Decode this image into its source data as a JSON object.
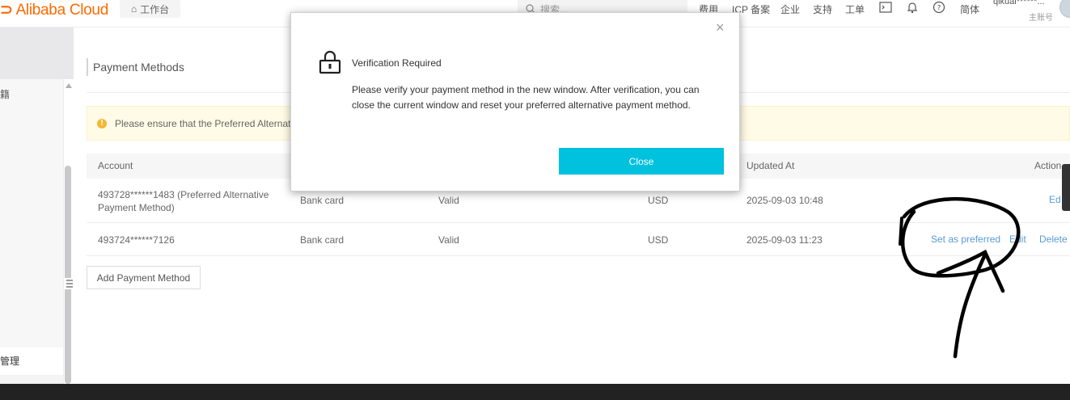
{
  "header": {
    "logo_text": "Alibaba Cloud",
    "workbench_label": "工作台",
    "search_placeholder": "搜索...",
    "nav": [
      "费用",
      "ICP 备案",
      "企业",
      "支持",
      "工单"
    ],
    "lang": "简体",
    "user_name": "qikuai******...",
    "user_role": "主账号"
  },
  "sidebar": {
    "clipped_label": "籍",
    "selected_item": "管理"
  },
  "page": {
    "title": "Payment Methods",
    "alert_text": "Please ensure that the Preferred Alternativ"
  },
  "table": {
    "columns": [
      "Account",
      "Updated At",
      "Action"
    ],
    "rows": [
      {
        "account": "493728******1483 (Preferred Alternative Payment Method)",
        "type": "Bank card",
        "status": "Valid",
        "currency": "USD",
        "updated": "2025-09-03 10:48",
        "actions": [
          "Ed"
        ]
      },
      {
        "account": "493724******7126",
        "type": "Bank card",
        "status": "Valid",
        "currency": "USD",
        "updated": "2025-09-03 11:23",
        "actions": [
          "Set as preferred",
          "Edit",
          "Delete"
        ]
      }
    ]
  },
  "add_button": "Add Payment Method",
  "modal": {
    "title": "Verification Required",
    "message": "Please verify your payment method in the new window. After verification, you can close the current window and reset your preferred alternative payment method.",
    "close_label": "Close",
    "close_icon": "×"
  },
  "colors": {
    "brand": "#ff6a00",
    "primary_button": "#00c1de",
    "link": "#5b9bd5",
    "alert_bg": "#fffbe6"
  }
}
